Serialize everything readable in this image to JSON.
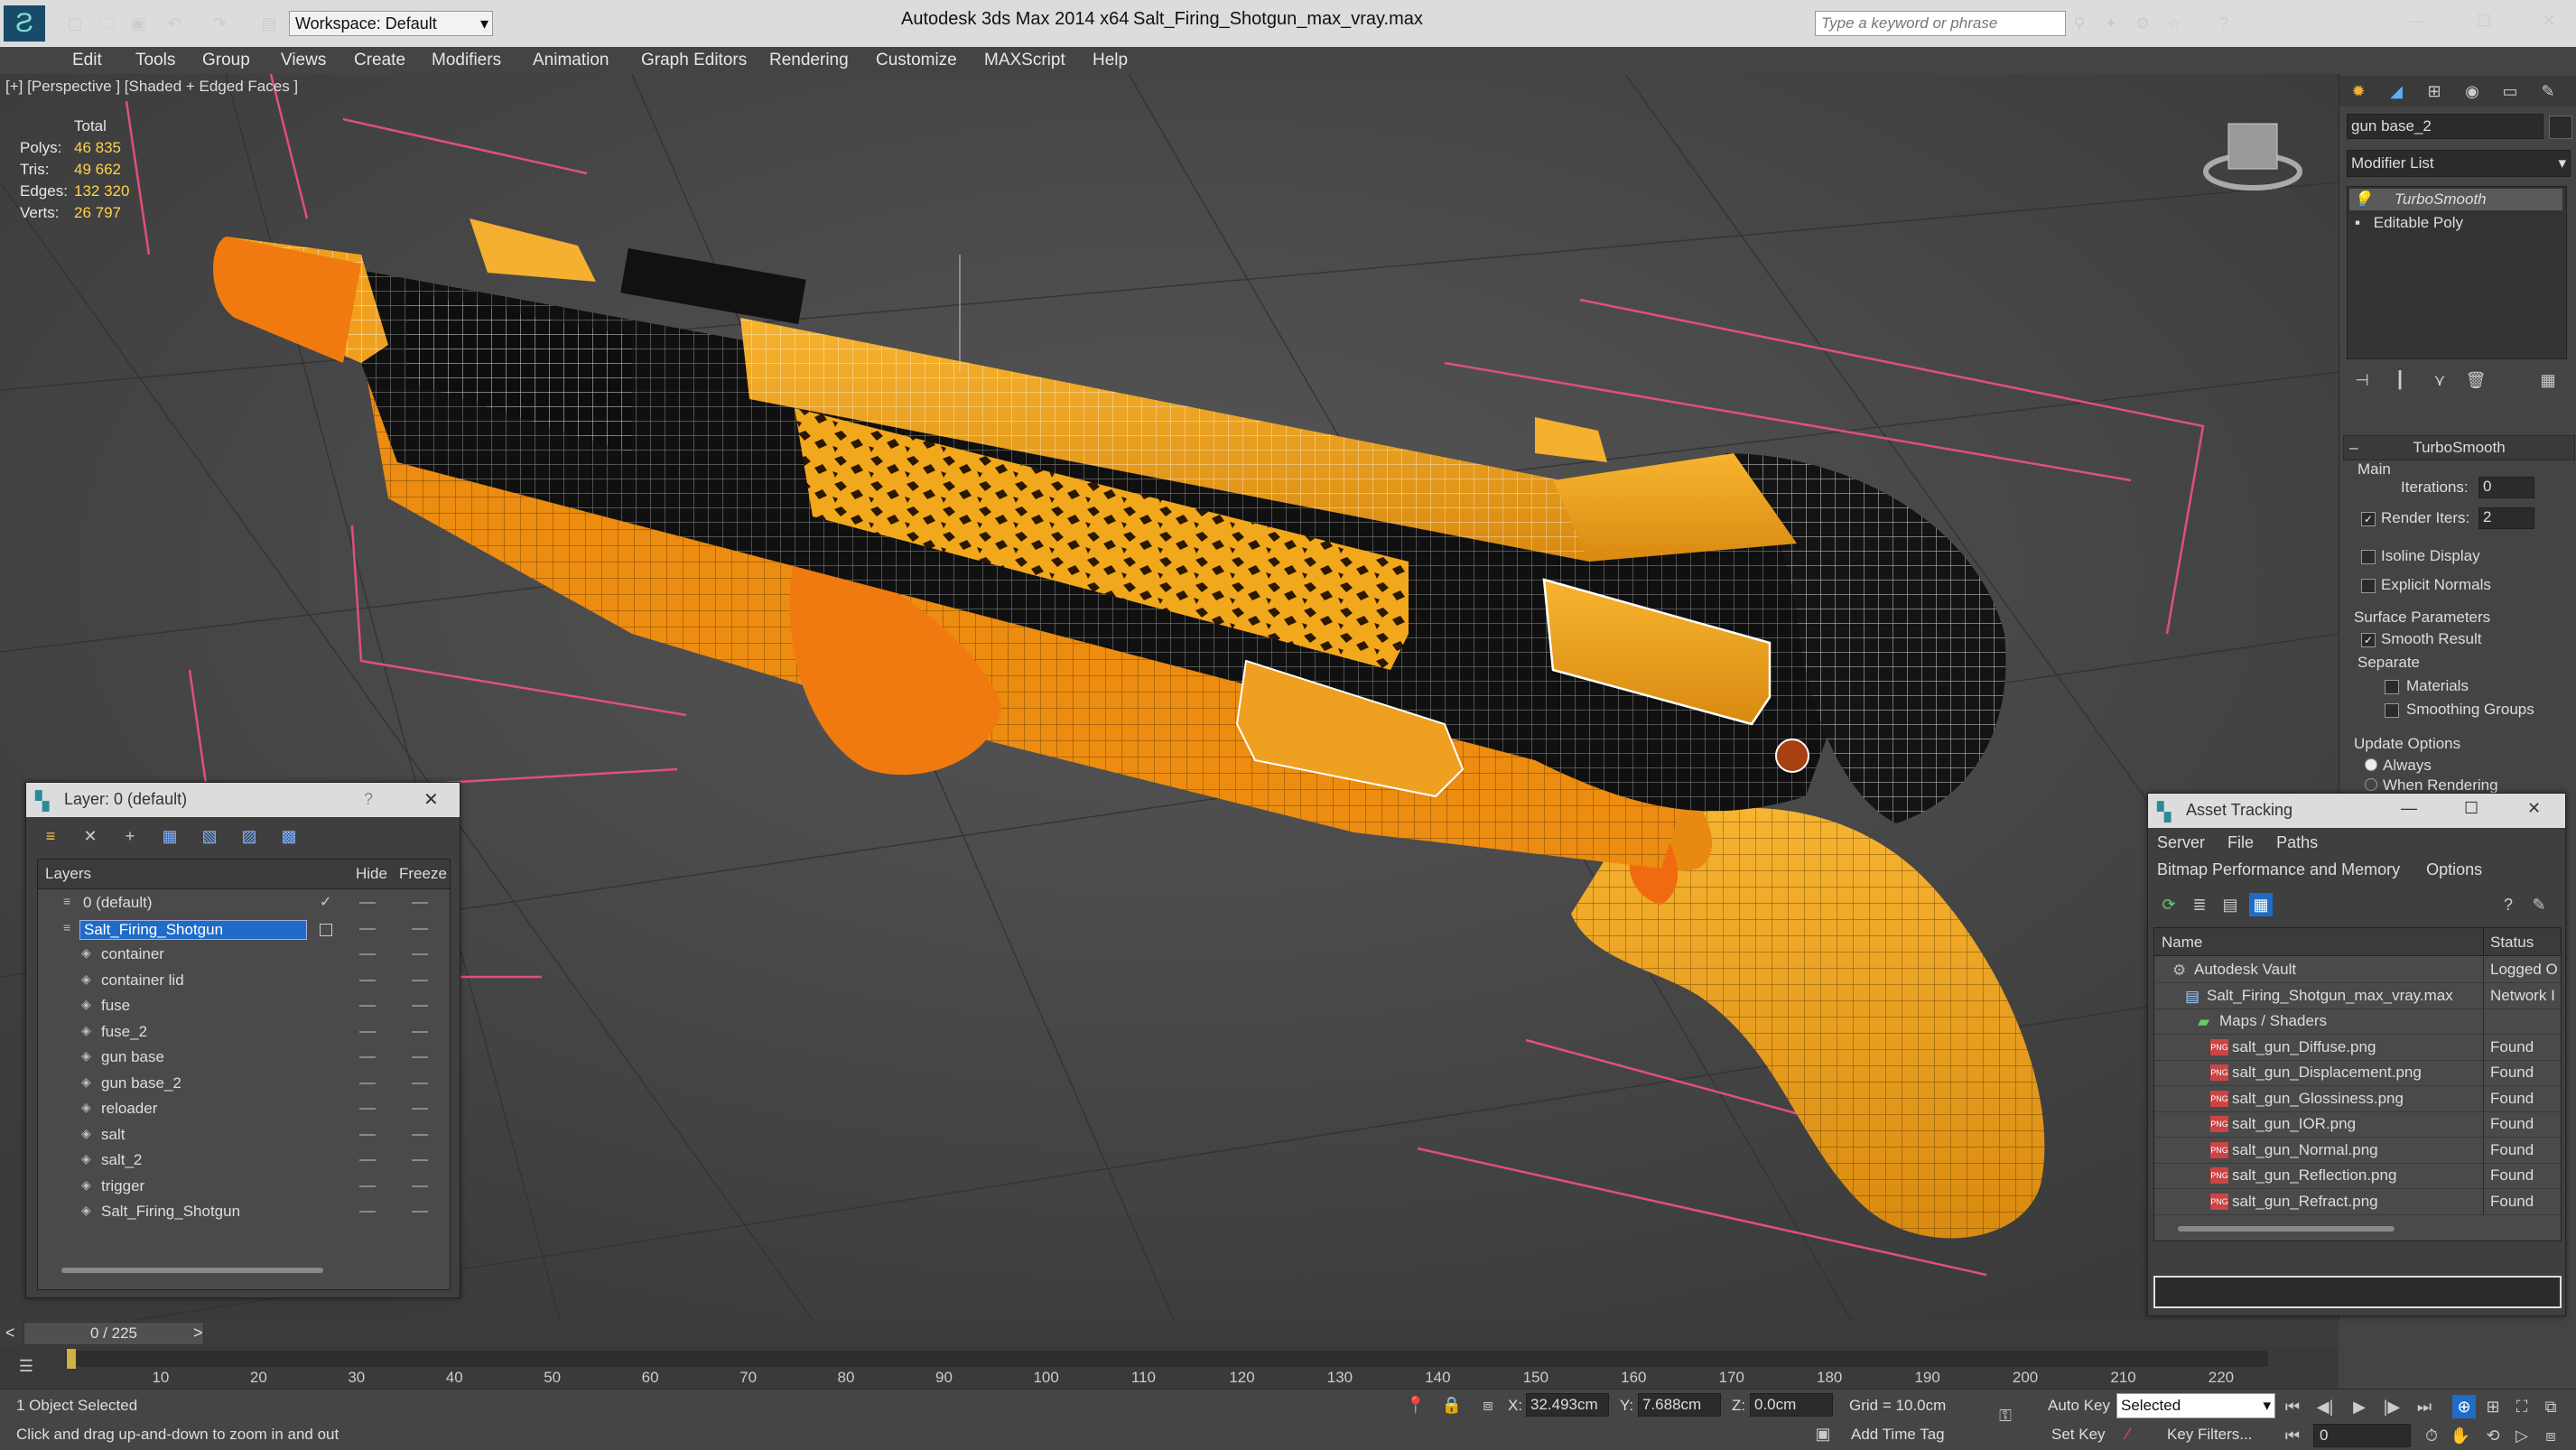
{
  "app": {
    "title": "Autodesk 3ds Max  2014 x64",
    "filename": "Salt_Firing_Shotgun_max_vray.max",
    "workspace": "Workspace: Default",
    "search_placeholder": "Type a keyword or phrase"
  },
  "menu": [
    "Edit",
    "Tools",
    "Group",
    "Views",
    "Create",
    "Modifiers",
    "Animation",
    "Graph Editors",
    "Rendering",
    "Customize",
    "MAXScript",
    "Help"
  ],
  "viewport": {
    "label": "[+] [Perspective ] [Shaded + Edged Faces ]",
    "stats": {
      "header": "Total",
      "rows": [
        {
          "label": "Polys:",
          "value": "46 835"
        },
        {
          "label": "Tris:",
          "value": "49 662"
        },
        {
          "label": "Edges:",
          "value": "132 320"
        },
        {
          "label": "Verts:",
          "value": "26 797"
        }
      ]
    }
  },
  "command_panel": {
    "object_name": "gun base_2",
    "modifier_list": "Modifier List",
    "stack": [
      "TurboSmooth",
      "Editable Poly"
    ],
    "rollout_title": "TurboSmooth",
    "main_label": "Main",
    "iterations_label": "Iterations:",
    "iterations_value": "0",
    "render_iters_label": "Render Iters:",
    "render_iters_value": "2",
    "isoline": "Isoline Display",
    "explicit_normals": "Explicit Normals",
    "surface_params": "Surface Parameters",
    "smooth_result": "Smooth Result",
    "separate": "Separate",
    "materials": "Materials",
    "smoothing_groups": "Smoothing Groups",
    "update_options": "Update Options",
    "always": "Always",
    "when_rendering": "When Rendering"
  },
  "layer_window": {
    "title": "Layer: 0 (default)",
    "col_layers": "Layers",
    "col_hide": "Hide",
    "col_freeze": "Freeze",
    "layers": [
      {
        "name": "0 (default)",
        "level": 0,
        "checked": true
      },
      {
        "name": "Salt_Firing_Shotgun",
        "level": 0,
        "selected": true
      },
      {
        "name": "container",
        "level": 1
      },
      {
        "name": "container lid",
        "level": 1
      },
      {
        "name": "fuse",
        "level": 1
      },
      {
        "name": "fuse_2",
        "level": 1
      },
      {
        "name": "gun base",
        "level": 1
      },
      {
        "name": "gun base_2",
        "level": 1
      },
      {
        "name": "reloader",
        "level": 1
      },
      {
        "name": "salt",
        "level": 1
      },
      {
        "name": "salt_2",
        "level": 1
      },
      {
        "name": "trigger",
        "level": 1
      },
      {
        "name": "Salt_Firing_Shotgun",
        "level": 1
      }
    ]
  },
  "asset_tracking": {
    "title": "Asset Tracking",
    "menu1": [
      "Server",
      "File",
      "Paths"
    ],
    "menu2": [
      "Bitmap Performance and Memory",
      "Options"
    ],
    "col_name": "Name",
    "col_status": "Status",
    "rows": [
      {
        "name": "Autodesk Vault",
        "status": "Logged O",
        "indent": 1,
        "icon": "vault"
      },
      {
        "name": "Salt_Firing_Shotgun_max_vray.max",
        "status": "Network I",
        "indent": 2,
        "icon": "max"
      },
      {
        "name": "Maps / Shaders",
        "status": "",
        "indent": 3,
        "icon": "maps"
      },
      {
        "name": "salt_gun_Diffuse.png",
        "status": "Found",
        "indent": 4,
        "icon": "png"
      },
      {
        "name": "salt_gun_Displacement.png",
        "status": "Found",
        "indent": 4,
        "icon": "png"
      },
      {
        "name": "salt_gun_Glossiness.png",
        "status": "Found",
        "indent": 4,
        "icon": "png"
      },
      {
        "name": "salt_gun_IOR.png",
        "status": "Found",
        "indent": 4,
        "icon": "png"
      },
      {
        "name": "salt_gun_Normal.png",
        "status": "Found",
        "indent": 4,
        "icon": "png"
      },
      {
        "name": "salt_gun_Reflection.png",
        "status": "Found",
        "indent": 4,
        "icon": "png"
      },
      {
        "name": "salt_gun_Refract.png",
        "status": "Found",
        "indent": 4,
        "icon": "png"
      }
    ]
  },
  "timeline": {
    "frame": "0 / 225",
    "ticks": [
      "10",
      "20",
      "30",
      "40",
      "50",
      "60",
      "70",
      "80",
      "90",
      "100",
      "110",
      "120",
      "130",
      "140",
      "150",
      "160",
      "170",
      "180",
      "190",
      "200",
      "210",
      "220"
    ]
  },
  "status": {
    "selected": "1 Object Selected",
    "prompt": "Click and drag up-and-down to zoom in and out",
    "x_label": "X:",
    "x_value": "32.493cm",
    "y_label": "Y:",
    "y_value": "7.688cm",
    "z_label": "Z:",
    "z_value": "0.0cm",
    "grid": "Grid = 10.0cm",
    "add_time_tag": "Add Time Tag",
    "auto_key": "Auto Key",
    "set_key": "Set Key",
    "selected_dropdown": "Selected",
    "key_filters": "Key Filters...",
    "frame_field": "0"
  },
  "colors": {
    "gun_orange": "#f0a020",
    "accent_blue": "#1e6cc8",
    "selection_box": "#e0507a"
  }
}
